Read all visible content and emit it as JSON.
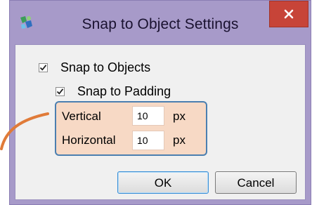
{
  "window": {
    "title": "Snap to Object Settings",
    "close_glyph": "×",
    "icon": "app-icon"
  },
  "options": {
    "snap_objects": {
      "label": "Snap to Objects",
      "checked": true
    },
    "snap_padding": {
      "label": "Snap to Padding",
      "checked": true
    }
  },
  "padding": {
    "vertical": {
      "label": "Vertical",
      "value": "10",
      "unit": "px"
    },
    "horizontal": {
      "label": "Horizontal",
      "value": "10",
      "unit": "px"
    }
  },
  "buttons": {
    "ok_label": "OK",
    "cancel_label": "Cancel"
  },
  "colors": {
    "frame": "#a79ac9",
    "close": "#c74438",
    "group_fill": "#f7d9c5",
    "group_border": "#4b7fb0",
    "callout": "#e07b39"
  }
}
